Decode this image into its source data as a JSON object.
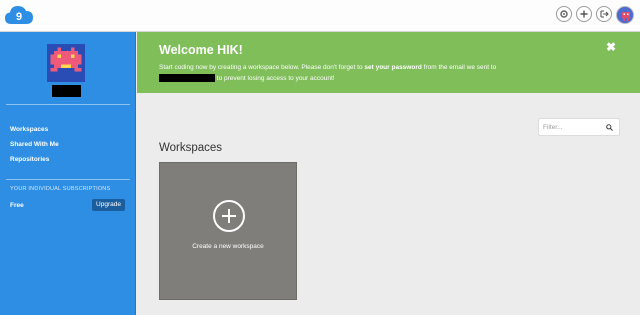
{
  "topbar": {
    "logo_icon": "cloud9-logo-icon",
    "logo_text": "9",
    "icons": [
      "gear-icon",
      "plus-icon",
      "logout-icon"
    ],
    "avatar_icon": "user-avatar-icon"
  },
  "sidebar": {
    "avatar_icon": "pixel-invader-avatar-icon",
    "nav": [
      "Workspaces",
      "Shared With Me",
      "Repositories"
    ],
    "subscriptions_heading": "YOUR INDIVIDUAL SUBSCRIPTIONS",
    "plan_name": "Free",
    "upgrade_label": "Upgrade"
  },
  "banner": {
    "title": "Welcome HIK!",
    "text_before": "Start coding now by creating a workspace below. Please don't forget to ",
    "text_bold": "set your password",
    "text_after": " from the email we sent to",
    "text_line2": " to prevent losing access to your account!",
    "close_label": "✖"
  },
  "main": {
    "filter_placeholder": "Filter...",
    "heading": "Workspaces",
    "new_workspace_label": "Create a new workspace"
  },
  "colors": {
    "sidebar": "#2e8ee3",
    "banner": "#7fbe59",
    "card": "#807e7b",
    "background": "#ececec"
  }
}
